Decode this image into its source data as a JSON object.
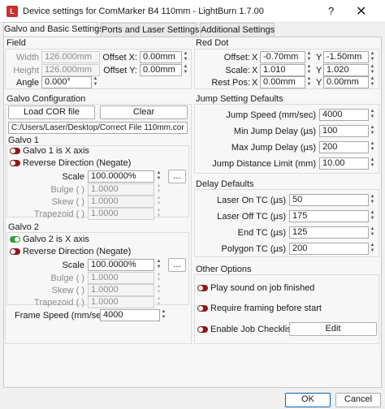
{
  "window": {
    "title": "Device settings for ComMarker B4 110mm - LightBurn 1.7.00",
    "help_glyph": "?",
    "close_glyph": "✕"
  },
  "tabs": [
    {
      "label": "Galvo and Basic Settings"
    },
    {
      "label": "Ports and Laser Settings"
    },
    {
      "label": "Additional Settings"
    }
  ],
  "field": {
    "title": "Field",
    "width_label": "Width",
    "width_value": "126.000mm",
    "height_label": "Height",
    "height_value": "126.000mm",
    "angle_label": "Angle",
    "angle_value": "0.000°",
    "offset_x_label": "Offset X:",
    "offset_x_value": "0.00mm",
    "offset_y_label": "Offset Y:",
    "offset_y_value": "0.00mm"
  },
  "red_dot": {
    "title": "Red Dot",
    "offset_label": "Offset:",
    "offset_x_label": "X",
    "offset_x_value": "-0.70mm",
    "offset_y_label": "Y",
    "offset_y_value": "-1.50mm",
    "scale_label": "Scale:",
    "scale_x_label": "X",
    "scale_x_value": "1.010",
    "scale_y_label": "Y",
    "scale_y_value": "1.020",
    "rest_label": "Rest Pos:",
    "rest_x_label": "X",
    "rest_x_value": "0.00mm",
    "rest_y_label": "Y",
    "rest_y_value": "0.00mm"
  },
  "galvo_config": {
    "title": "Galvo Configuration",
    "load_cor_label": "Load COR file",
    "clear_label": "Clear",
    "cor_path": "C:/Users/Laser/Desktop/Correct File 110mm.cor"
  },
  "galvo1": {
    "title": "Galvo 1",
    "x_axis_label": "Galvo 1 is X axis",
    "reverse_label": "Reverse Direction (Negate)",
    "scale_label": "Scale",
    "scale_value": "100.0000%",
    "bulge_label": "Bulge ( )",
    "bulge_value": "1.0000",
    "skew_label": "Skew ( )",
    "skew_value": "1.0000",
    "trapezoid_label": "Trapezoid ( )",
    "trapezoid_value": "1.0000",
    "more_label": "..."
  },
  "galvo2": {
    "title": "Galvo 2",
    "x_axis_label": "Galvo 2 is X axis",
    "reverse_label": "Reverse Direction (Negate)",
    "scale_label": "Scale",
    "scale_value": "100.0000%",
    "bulge_label": "Bulge ( )",
    "bulge_value": "1.0000",
    "skew_label": "Skew ( )",
    "skew_value": "1.0000",
    "trapezoid_label": "Trapezoid ( )",
    "trapezoid_value": "1.0000",
    "more_label": "..."
  },
  "frame_speed": {
    "label": "Frame Speed (mm/sec)",
    "value": "4000"
  },
  "jump": {
    "title": "Jump Setting Defaults",
    "speed_label": "Jump Speed (mm/sec)",
    "speed_value": "4000",
    "min_delay_label": "Min Jump Delay (µs)",
    "min_delay_value": "100",
    "max_delay_label": "Max Jump Delay (µs)",
    "max_delay_value": "200",
    "limit_label": "Jump Distance Limit (mm)",
    "limit_value": "10.00"
  },
  "delay": {
    "title": "Delay Defaults",
    "laser_on_label": "Laser On TC (µs)",
    "laser_on_value": "50",
    "laser_off_label": "Laser Off TC (µs)",
    "laser_off_value": "175",
    "end_label": "End TC (µs)",
    "end_value": "125",
    "polygon_label": "Polygon TC (µs)",
    "polygon_value": "200"
  },
  "other": {
    "title": "Other Options",
    "play_sound_label": "Play sound on job finished",
    "require_framing_label": "Require framing before start",
    "job_checklist_label": "Enable Job Checklist",
    "edit_label": "Edit"
  },
  "footer": {
    "ok_label": "OK",
    "cancel_label": "Cancel"
  },
  "colors": {
    "toggle_off": "#8b1a1a",
    "toggle_on": "#2e9e3a",
    "accent": "#0067c0"
  }
}
